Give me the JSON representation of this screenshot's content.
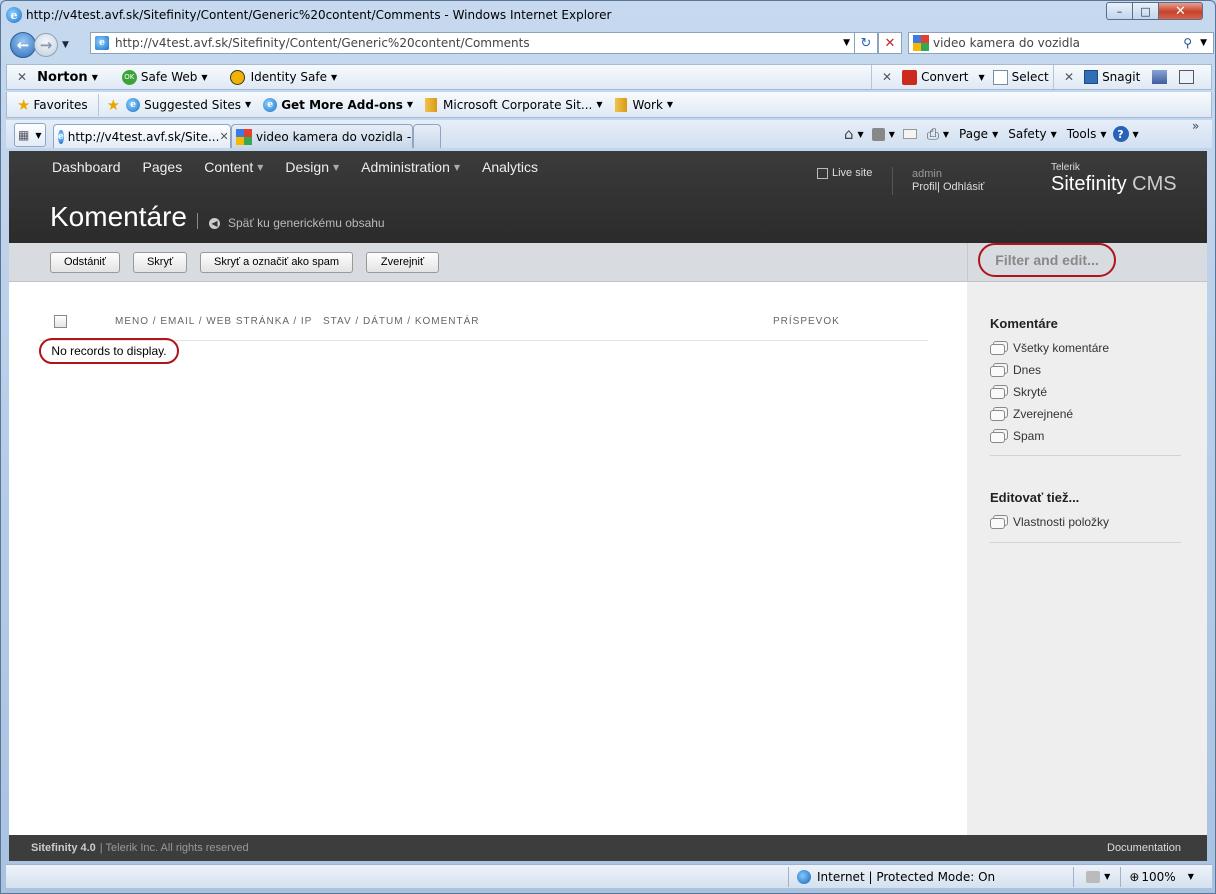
{
  "window": {
    "title": "http://v4test.avf.sk/Sitefinity/Content/Generic%20content/Comments - Windows Internet Explorer",
    "min_glyph": "–",
    "max_glyph": "□",
    "close_glyph": "✕"
  },
  "address": {
    "url": "http://v4test.avf.sk/Sitefinity/Content/Generic%20content/Comments",
    "refresh_glyph": "↻",
    "stop_glyph": "✕"
  },
  "search": {
    "value": "video kamera do vozidla",
    "icon_glyph": "⚲"
  },
  "toolbar1": {
    "norton": "Norton",
    "safe_web": "Safe Web",
    "identity_safe": "Identity Safe",
    "convert": "Convert",
    "select": "Select",
    "snagit": "Snagit"
  },
  "favorites": {
    "favorites": "Favorites",
    "suggested_sites": "Suggested Sites",
    "get_more": "Get More Add-ons",
    "microsoft": "Microsoft Corporate Sit...",
    "work": "Work"
  },
  "tabs": [
    {
      "label": "http://v4test.avf.sk/Site..."
    },
    {
      "label": "video kamera do vozidla - ..."
    }
  ],
  "commandbar": {
    "page": "Page",
    "safety": "Safety",
    "tools": "Tools",
    "more": "»"
  },
  "cms": {
    "nav": [
      "Dashboard",
      "Pages",
      "Content",
      "Design",
      "Administration",
      "Analytics"
    ],
    "live_site": "Live site",
    "user": "admin",
    "profile": "Profil",
    "logout": "Odhlásiť",
    "logo_small": "Telerik",
    "logo_main": "Sitefinity",
    "logo_cms": "CMS",
    "page_title": "Komentáre",
    "back_link": "Späť ku generickému obsahu",
    "actions": [
      "Odstániť",
      "Skryť",
      "Skryť a označiť ako spam",
      "Zverejniť"
    ],
    "filter_label": "Filter and edit...",
    "columns": {
      "name": "MENO / EMAIL / WEB STRÁNKA / IP",
      "status": "STAV / DÁTUM / KOMENTÁR",
      "post": "PRÍSPEVOK"
    },
    "no_records": "No records to display.",
    "side": {
      "heading1": "Komentáre",
      "items1": [
        "Všetky komentáre",
        "Dnes",
        "Skryté",
        "Zverejnené",
        "Spam"
      ],
      "heading2": "Editovať tiež...",
      "items2": [
        "Vlastnosti položky"
      ]
    },
    "footer": {
      "product": "Sitefinity 4.0",
      "copyright": "| Telerik Inc. All rights reserved",
      "documentation": "Documentation"
    }
  },
  "statusbar": {
    "zone": "Internet | Protected Mode: On",
    "zoom": "100%"
  }
}
